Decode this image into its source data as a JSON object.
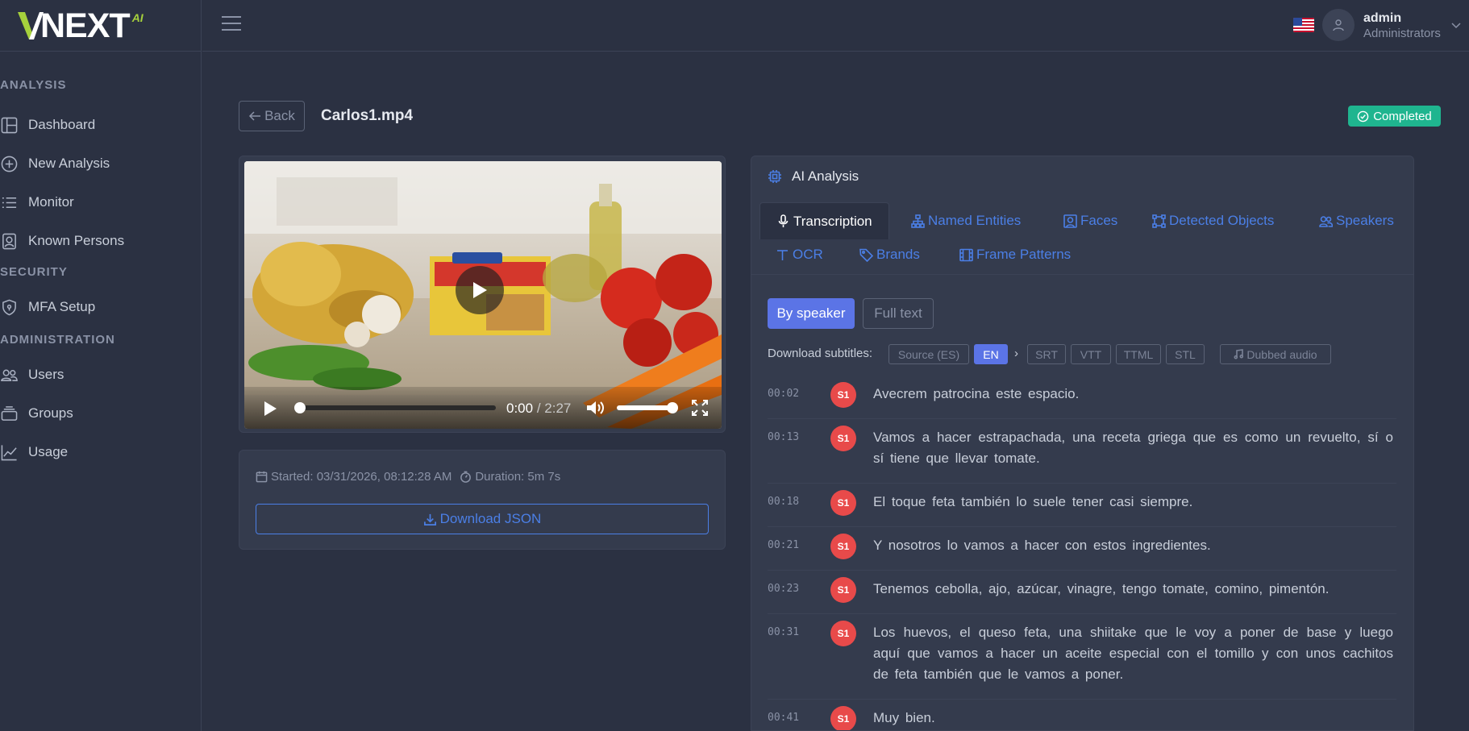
{
  "app": {
    "logo_text": "NEXT",
    "logo_suffix": "AI"
  },
  "sidebar": {
    "sections": [
      {
        "title": "ANALYSIS",
        "items": [
          {
            "label": "Dashboard",
            "icon": "dashboard-icon"
          },
          {
            "label": "New Analysis",
            "icon": "plus-circle-icon"
          },
          {
            "label": "Monitor",
            "icon": "list-icon"
          },
          {
            "label": "Known Persons",
            "icon": "person-badge-icon"
          }
        ]
      },
      {
        "title": "SECURITY",
        "items": [
          {
            "label": "MFA Setup",
            "icon": "shield-icon"
          }
        ]
      },
      {
        "title": "ADMINISTRATION",
        "items": [
          {
            "label": "Users",
            "icon": "users-icon"
          },
          {
            "label": "Groups",
            "icon": "stack-icon"
          },
          {
            "label": "Usage",
            "icon": "chart-line-icon"
          }
        ]
      }
    ]
  },
  "topbar": {
    "user_name": "admin",
    "user_role": "Administrators",
    "language_flag": "us-flag-icon"
  },
  "page": {
    "back_label": "Back",
    "file_name": "Carlos1.mp4",
    "status": "Completed",
    "status_color": "#1fb58f"
  },
  "player": {
    "current_time": "0:00",
    "duration": "2:27",
    "progress": 0,
    "volume": 1.0
  },
  "meta": {
    "started": "Started: 03/31/2026, 08:12:28 AM",
    "duration": "Duration: 5m 7s",
    "download_json": "Download JSON"
  },
  "ai": {
    "title": "AI Analysis",
    "tabs": [
      {
        "label": "Transcription",
        "icon": "microphone-icon",
        "active": true
      },
      {
        "label": "Named Entities",
        "icon": "sitemap-icon"
      },
      {
        "label": "Faces",
        "icon": "face-icon"
      },
      {
        "label": "Detected Objects",
        "icon": "bounding-box-icon"
      },
      {
        "label": "Speakers",
        "icon": "people-icon"
      },
      {
        "label": "OCR",
        "icon": "text-icon"
      },
      {
        "label": "Brands",
        "icon": "tag-icon"
      },
      {
        "label": "Frame Patterns",
        "icon": "film-icon"
      }
    ],
    "view_mode": {
      "by_speaker": "By speaker",
      "full_text": "Full text"
    },
    "download_subtitles_label": "Download subtitles:",
    "subtitle_langs": [
      "Source (ES)",
      "EN"
    ],
    "separator": "›",
    "subtitle_formats": [
      "SRT",
      "VTT",
      "TTML",
      "STL"
    ],
    "dubbed_audio": "Dubbed audio",
    "accent_color": "#4b7fe6"
  },
  "transcript": [
    {
      "time": "00:02",
      "speaker": "S1",
      "text": "Avecrem patrocina este espacio."
    },
    {
      "time": "00:13",
      "speaker": "S1",
      "text": "Vamos a hacer estrapachada, una receta griega que es como un revuelto, sí o sí tiene que llevar tomate."
    },
    {
      "time": "00:18",
      "speaker": "S1",
      "text": "El toque feta también lo suele tener casi siempre."
    },
    {
      "time": "00:21",
      "speaker": "S1",
      "text": "Y nosotros lo vamos a hacer con estos ingredientes."
    },
    {
      "time": "00:23",
      "speaker": "S1",
      "text": "Tenemos cebolla, ajo, azúcar, vinagre, tengo tomate, comino, pimentón."
    },
    {
      "time": "00:31",
      "speaker": "S1",
      "text": "Los huevos, el queso feta, una shiitake que le voy a poner de base y luego aquí que vamos a hacer un aceite especial con el tomillo y con unos cachitos de feta también que le vamos a poner."
    },
    {
      "time": "00:41",
      "speaker": "S1",
      "text": "Muy bien."
    }
  ]
}
